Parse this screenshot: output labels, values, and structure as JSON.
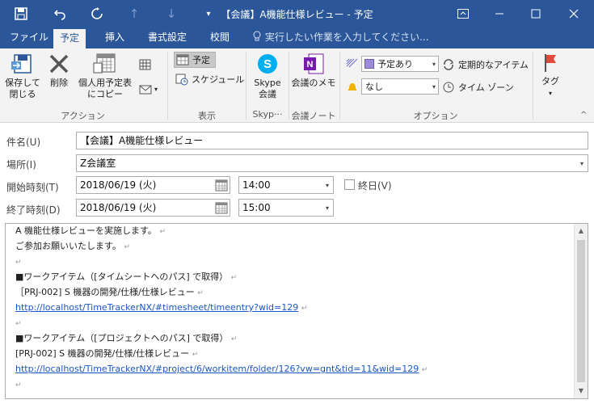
{
  "window": {
    "title": "【会議】A機能仕様レビュー - 予定"
  },
  "tabs": [
    {
      "label": "ファイル"
    },
    {
      "label": "予定"
    },
    {
      "label": "挿入"
    },
    {
      "label": "書式設定"
    },
    {
      "label": "校閲"
    }
  ],
  "tell_me": "実行したい作業を入力してください...",
  "ribbon": {
    "actions": {
      "save_close": "保存して閉じる",
      "save_close_l1": "保存して",
      "save_close_l2": "閉じる",
      "delete": "削除",
      "copy_l1": "個人用予定表",
      "copy_l2": "にコピー",
      "group": "アクション"
    },
    "show": {
      "appointment": "予定",
      "schedule": "スケジュール",
      "group": "表示"
    },
    "skype": {
      "l1": "Skype",
      "l2": "会議",
      "group": "Skyp···"
    },
    "notes": {
      "label": "会議のメモ",
      "group": "会議ノート"
    },
    "options": {
      "show_as": "予定あり",
      "reminder": "なし",
      "recurrence": "定期的なアイテム",
      "time_zone": "タイム ゾーン",
      "group": "オプション"
    },
    "tags": {
      "label": "タグ"
    }
  },
  "form": {
    "subject_label": "件名(U)",
    "subject_value": "【会議】A機能仕様レビュー",
    "location_label": "場所(I)",
    "location_value": "Z会議室",
    "start_label": "開始時刻(T)",
    "start_date": "2018/06/19 (火)",
    "start_time": "14:00",
    "allday_label": "終日(V)",
    "end_label": "終了時刻(D)",
    "end_date": "2018/06/19 (火)",
    "end_time": "15:00"
  },
  "body": {
    "line1": "A 機能仕様レビューを実施します。",
    "line2": "ご参加お願いいたします。",
    "line4": "■ワークアイテム（[タイムシートへのパス] で取得）",
    "line5": "［PRJ-002] S 機器の開発/仕様/仕様レビュー",
    "line6": "http://localhost/TimeTrackerNX/#timesheet/timeentry?wid=129",
    "line8": "■ワークアイテム（[プロジェクトへのパス] で取得）",
    "line9": "[PRJ-002] S 機器の開発/仕様/仕様レビュー",
    "line10": "http://localhost/TimeTrackerNX/#project/6/workitem/folder/126?vw=gnt&tid=11&wid=129",
    "mark": "↵"
  }
}
